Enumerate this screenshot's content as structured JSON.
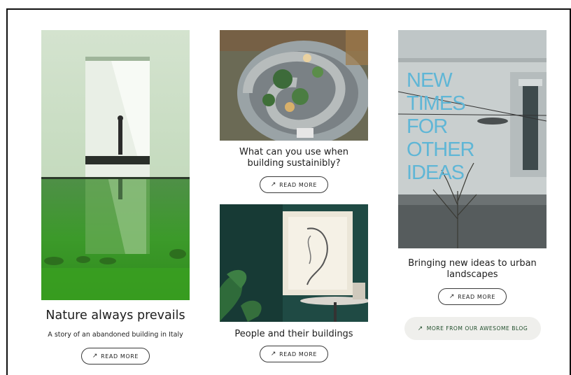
{
  "cards": [
    {
      "title": "Nature always prevails",
      "subtitle": "A story of an abandoned building in Italy",
      "button": "READ MORE"
    },
    {
      "title": "What can you use when building sustainibly?",
      "button": "READ MORE"
    },
    {
      "title": "People and their buildings",
      "button": "READ MORE"
    },
    {
      "title": "Bringing new ideas to urban landscapes",
      "button": "READ MORE"
    }
  ],
  "neon_sign": [
    "NEW",
    "TIMES",
    "FOR",
    "OTHER",
    "IDEAS"
  ],
  "blog_button": "MORE FROM OUR AWESOME BLOG",
  "icons": {
    "button_arrow": "arrow-up-right-icon"
  },
  "colors": {
    "blog_text": "#1f4d2a",
    "blog_bg": "#efefec",
    "neon": "#5fb6d6"
  }
}
